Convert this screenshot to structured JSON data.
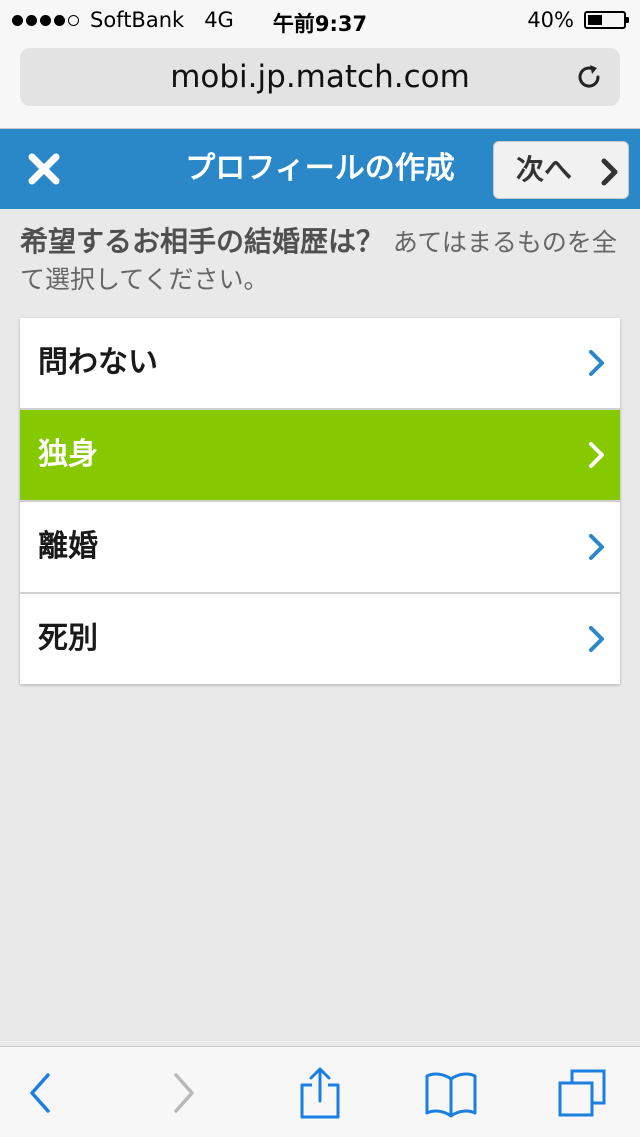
{
  "status_bar": {
    "carrier": "SoftBank",
    "network": "4G",
    "time": "午前9:37",
    "battery_text": "40%",
    "battery_level": 0.4,
    "signal_bars_filled": 4,
    "signal_bars_total": 5
  },
  "browser": {
    "url": "mobi.jp.match.com"
  },
  "nav": {
    "title": "プロフィールの作成",
    "next_label": "次へ",
    "accent_color": "#2a87c8"
  },
  "question": {
    "main": "希望するお相手の結婚歴は？",
    "sub": "あてはまるものを全て選択してください。"
  },
  "options": [
    {
      "label": "問わない",
      "selected": false
    },
    {
      "label": "独身",
      "selected": true
    },
    {
      "label": "離婚",
      "selected": false
    },
    {
      "label": "死別",
      "selected": false
    }
  ],
  "colors": {
    "selected": "#86c900",
    "chevron": "#2a87c8"
  },
  "toolbar_icons": [
    "back-icon",
    "forward-icon",
    "share-icon",
    "bookmarks-icon",
    "tabs-icon"
  ]
}
